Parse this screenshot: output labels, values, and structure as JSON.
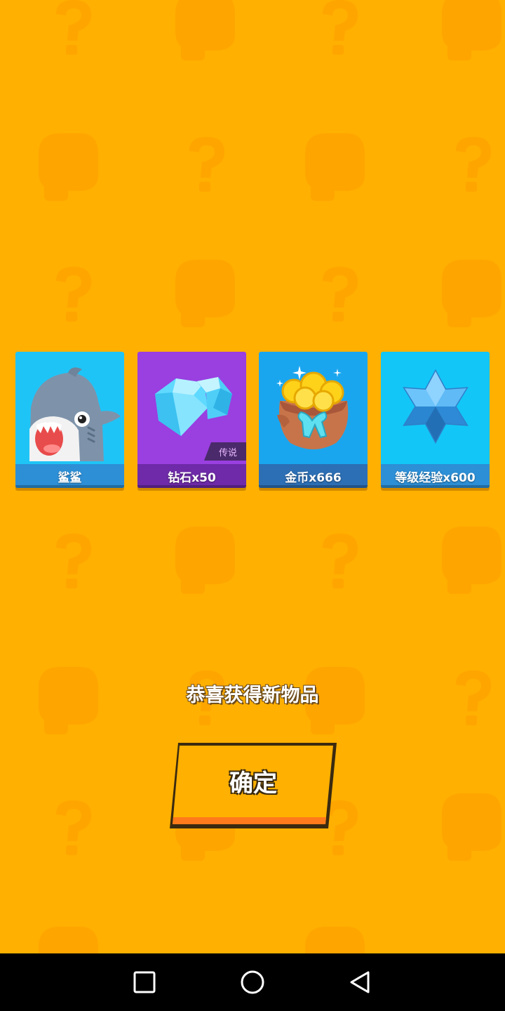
{
  "rewards": [
    {
      "name": "鲨鲨",
      "icon": "shark-icon"
    },
    {
      "name": "钻石x50",
      "icon": "diamond-icon",
      "rarity": "传说"
    },
    {
      "name": "金币x666",
      "icon": "gold-coin-bag-icon"
    },
    {
      "name": "等级经验x600",
      "icon": "exp-star-icon"
    }
  ],
  "message": "恭喜获得新物品",
  "confirm_label": "确定",
  "navbar": {
    "recent_icon": "recent-apps-icon",
    "home_icon": "home-icon",
    "back_icon": "back-icon"
  },
  "colors": {
    "background": "#ffb000",
    "shark_card": "#1fc4f7",
    "diamond_card": "#9a3fe0",
    "gold_card": "#1aa6ef",
    "exp_card": "#12c6f8"
  }
}
